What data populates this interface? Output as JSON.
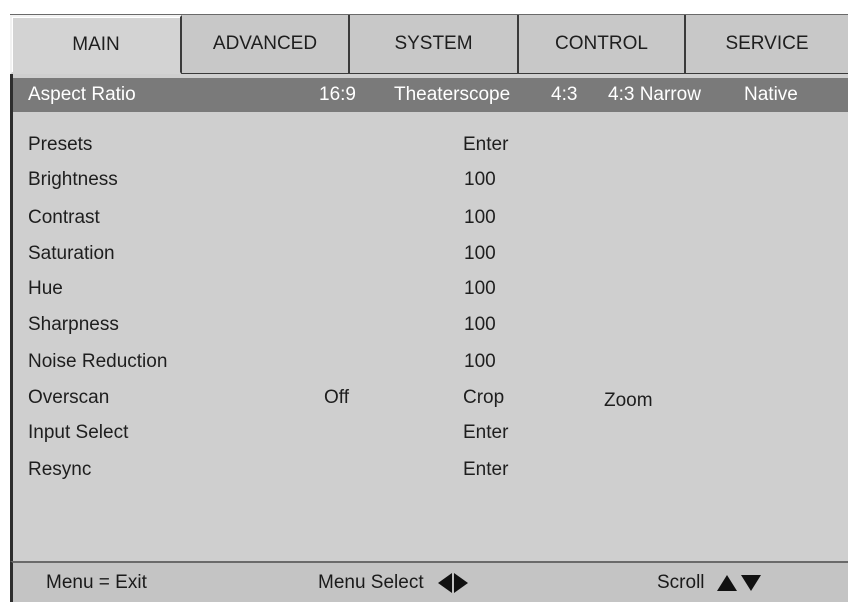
{
  "tabs": [
    {
      "label": "MAIN",
      "active": true
    },
    {
      "label": "ADVANCED",
      "active": false
    },
    {
      "label": "SYSTEM",
      "active": false
    },
    {
      "label": "CONTROL",
      "active": false
    },
    {
      "label": "SERVICE",
      "active": false
    }
  ],
  "menu": {
    "aspect_ratio": {
      "label": "Aspect Ratio",
      "options": [
        "16:9",
        "Theaterscope",
        "4:3",
        "4:3 Narrow",
        "Native"
      ]
    },
    "presets": {
      "label": "Presets",
      "value": "Enter"
    },
    "brightness": {
      "label": "Brightness",
      "value": "100"
    },
    "contrast": {
      "label": "Contrast",
      "value": "100"
    },
    "saturation": {
      "label": "Saturation",
      "value": "100"
    },
    "hue": {
      "label": "Hue",
      "value": "100"
    },
    "sharpness": {
      "label": "Sharpness",
      "value": "100"
    },
    "noise_reduction": {
      "label": "Noise Reduction",
      "value": "100"
    },
    "overscan": {
      "label": "Overscan",
      "options": [
        "Off",
        "Crop",
        "Zoom"
      ]
    },
    "input_select": {
      "label": "Input Select",
      "value": "Enter"
    },
    "resync": {
      "label": "Resync",
      "value": "Enter"
    }
  },
  "footer": {
    "exit": "Menu = Exit",
    "select": "Menu Select",
    "scroll": "Scroll"
  },
  "icons": {
    "left": "left-arrow-icon",
    "right": "right-arrow-icon",
    "up": "up-arrow-icon",
    "down": "down-arrow-icon"
  },
  "colors": {
    "selected_row": "#7a7a7a",
    "panel": "#cfcfcf",
    "tab_bar": "#c6c6c6"
  }
}
